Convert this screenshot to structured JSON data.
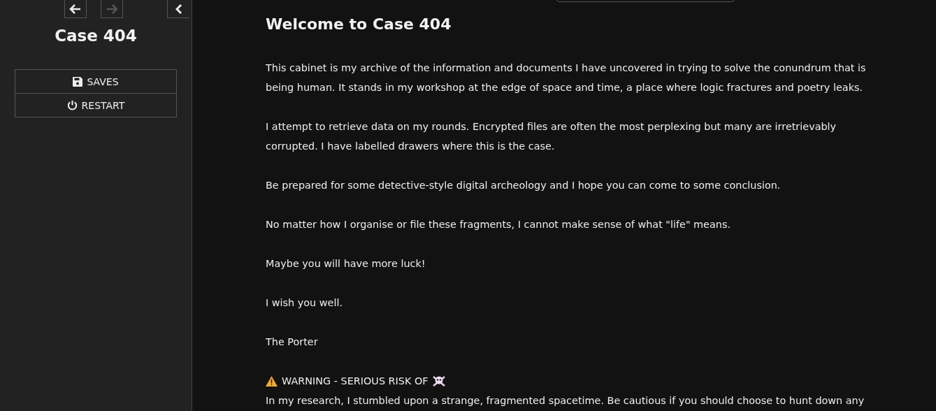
{
  "sidebar": {
    "nav": [
      {
        "kind": "back",
        "disabled": false
      },
      {
        "kind": "forward",
        "disabled": true
      }
    ],
    "collapse": {
      "kind": "collapse"
    },
    "title": "Case 404",
    "buttons": [
      {
        "kind": "save",
        "label": "SAVES"
      },
      {
        "kind": "restart",
        "label": "RESTART"
      }
    ]
  },
  "main": {
    "heading": "Welcome to Case 404",
    "paragraphs": [
      {
        "lines": [
          "This cabinet is my archive of the information and documents I have uncovered in trying to solve the conundrum that is",
          "being human. It stands in my workshop at the edge of space and time, a place where logic fractures and poetry leaks."
        ]
      },
      {
        "lines": [
          "I attempt to retrieve data on my rounds. Encrypted files are often the most perplexing but many are irretrievably",
          "corrupted. I have labelled drawers where this is the case."
        ]
      },
      {
        "lines": [
          "Be prepared for some detective-style digital archeology and I hope you can come to some conclusion."
        ]
      },
      {
        "lines": [
          "No matter how I organise or file these fragments, I cannot make sense of what \"life\" means."
        ]
      },
      {
        "lines": [
          "Maybe you will have more luck!"
        ]
      },
      {
        "lines": [
          "I wish you well."
        ]
      },
      {
        "lines": [
          "The Porter"
        ]
      }
    ],
    "warning": {
      "title": "WARNING - SERIOUS RISK OF",
      "lines": [
        "In my research, I stumbled upon a strange, fragmented spacetime. Be cautious if you should choose to hunt down any"
      ]
    }
  }
}
